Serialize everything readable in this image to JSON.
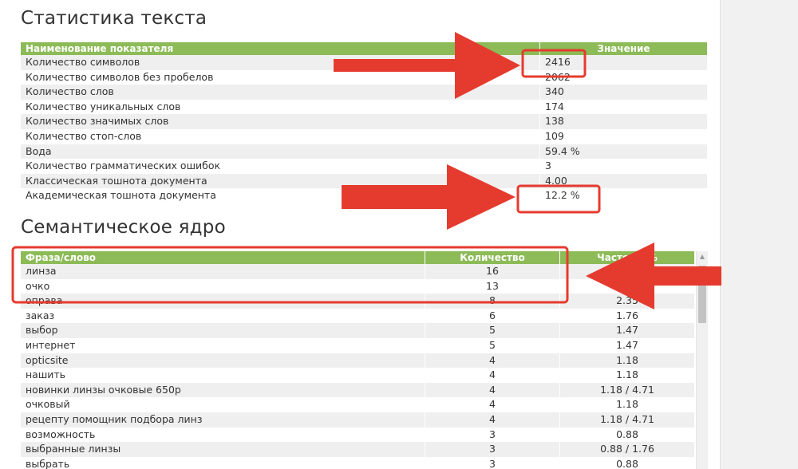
{
  "stats": {
    "title": "Статистика текста",
    "headers": [
      "Наименование показателя",
      "Значение"
    ],
    "rows": [
      {
        "label": "Количество символов",
        "value": "2416"
      },
      {
        "label": "Количество символов без пробелов",
        "value": "2062"
      },
      {
        "label": "Количество слов",
        "value": "340"
      },
      {
        "label": "Количество уникальных слов",
        "value": "174"
      },
      {
        "label": "Количество значимых слов",
        "value": "138"
      },
      {
        "label": "Количество стоп-слов",
        "value": "109"
      },
      {
        "label": "Вода",
        "value": "59.4 %"
      },
      {
        "label": "Количество грамматических ошибок",
        "value": "3"
      },
      {
        "label": "Классическая тошнота документа",
        "value": "4.00"
      },
      {
        "label": "Академическая тошнота документа",
        "value": "12.2 %"
      }
    ]
  },
  "semantic": {
    "title": "Семантическое ядро",
    "headers": [
      "Фраза/слово",
      "Количество",
      "Частота, %"
    ],
    "rows": [
      {
        "phrase": "линза",
        "count": "16",
        "freq": ""
      },
      {
        "phrase": "очко",
        "count": "13",
        "freq": ""
      },
      {
        "phrase": "оправа",
        "count": "8",
        "freq": "2.35"
      },
      {
        "phrase": "заказ",
        "count": "6",
        "freq": "1.76"
      },
      {
        "phrase": "выбор",
        "count": "5",
        "freq": "1.47"
      },
      {
        "phrase": "интернет",
        "count": "5",
        "freq": "1.47"
      },
      {
        "phrase": "opticsite",
        "count": "4",
        "freq": "1.18"
      },
      {
        "phrase": "нашить",
        "count": "4",
        "freq": "1.18"
      },
      {
        "phrase": "новинки линзы очковые 650р",
        "count": "4",
        "freq": "1.18 / 4.71"
      },
      {
        "phrase": "очковый",
        "count": "4",
        "freq": "1.18"
      },
      {
        "phrase": "рецепту помощник подбора линз",
        "count": "4",
        "freq": "1.18 / 4.71"
      },
      {
        "phrase": "возможность",
        "count": "3",
        "freq": "0.88"
      },
      {
        "phrase": "выбранные линзы",
        "count": "3",
        "freq": "0.88 / 1.76"
      },
      {
        "phrase": "выбрать",
        "count": "3",
        "freq": "0.88"
      }
    ]
  },
  "colors": {
    "header_green": "#8cbb57",
    "annotation_red": "#e53b2f",
    "row_stripe": "#efefef"
  }
}
